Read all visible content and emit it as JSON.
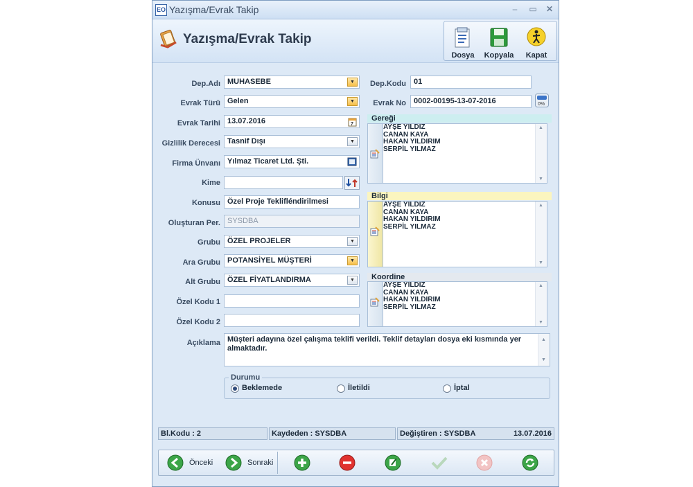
{
  "window": {
    "title": "Yazışma/Evrak Takip",
    "app_icon_text": "EO"
  },
  "header": {
    "title": "Yazışma/Evrak Takip"
  },
  "toolbar": {
    "file_label": "Dosya",
    "copy_label": "Kopyala",
    "close_label": "Kapat"
  },
  "form": {
    "dep_adi": {
      "label": "Dep.Adı",
      "value": "MUHASEBE"
    },
    "evrak_turu": {
      "label": "Evrak Türü",
      "value": "Gelen"
    },
    "evrak_tarihi": {
      "label": "Evrak Tarihi",
      "value": "13.07.2016"
    },
    "gizlilik": {
      "label": "Gizlilik Derecesi",
      "value": "Tasnif Dışı"
    },
    "firma": {
      "label": "Firma Ünvanı",
      "value": "Yılmaz Ticaret Ltd. Şti."
    },
    "kime": {
      "label": "Kime",
      "value": ""
    },
    "konusu": {
      "label": "Konusu",
      "value": "Özel Proje Teklifléndirilmesi"
    },
    "olusturan": {
      "label": "Oluşturan Per.",
      "value": "SYSDBA"
    },
    "grubu": {
      "label": "Grubu",
      "value": "ÖZEL PROJELER"
    },
    "ara_grubu": {
      "label": "Ara Grubu",
      "value": "POTANSİYEL MÜŞTERİ"
    },
    "alt_grubu": {
      "label": "Alt Grubu",
      "value": "ÖZEL FİYATLANDIRMA"
    },
    "ozel_kodu1": {
      "label": "Özel Kodu 1",
      "value": ""
    },
    "ozel_kodu2": {
      "label": "Özel Kodu 2",
      "value": ""
    },
    "aciklama": {
      "label": "Açıklama",
      "value": "Müşteri adayına özel çalışma teklifi verildi. Teklif detayları dosya eki kısmında yer almaktadır."
    },
    "dep_kodu": {
      "label": "Dep.Kodu",
      "value": "01"
    },
    "evrak_no": {
      "label": "Evrak No",
      "value": "0002-00195-13-07-2016"
    }
  },
  "lists": {
    "geregi": {
      "title": "Gereği",
      "items": [
        "AYŞE YILDIZ",
        "CANAN KAYA",
        "HAKAN YILDIRIM",
        "SERPİL YILMAZ"
      ]
    },
    "bilgi": {
      "title": "Bilgi",
      "items": [
        "AYŞE YILDIZ",
        "CANAN KAYA",
        "HAKAN YILDIRIM",
        "SERPİL YILMAZ"
      ]
    },
    "koordine": {
      "title": "Koordine",
      "items": [
        "AYŞE YILDIZ",
        "CANAN KAYA",
        "HAKAN YILDIRIM",
        "SERPİL YILMAZ"
      ]
    }
  },
  "durumu": {
    "title": "Durumu",
    "options": [
      "Beklemede",
      "İletildi",
      "İptal"
    ],
    "selected": "Beklemede"
  },
  "status": {
    "bl_kodu": "Bl.Kodu : 2",
    "kaydeden": "Kaydeden : SYSDBA",
    "degistiren": "Değiştiren : SYSDBA",
    "tarih": "13.07.2016"
  },
  "nav": {
    "prev_label": "Önceki",
    "next_label": "Sonraki"
  },
  "colors": {
    "geregi_header": "#cdeef0",
    "bilgi_header": "#fbf5bf",
    "koordine_header": "#e4e9ef"
  }
}
